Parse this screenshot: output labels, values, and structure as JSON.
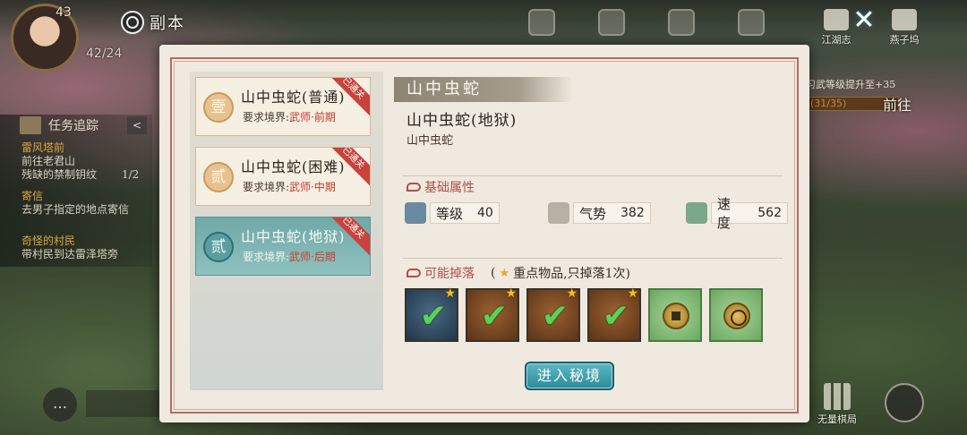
{
  "hud": {
    "player_level": "43",
    "stamina": "42/24",
    "dungeon_title": "副本",
    "right_buttons": [
      "江湖志",
      "燕子坞"
    ],
    "close_symbol": "✕",
    "board_label": "无量棋局"
  },
  "quest_tracker": {
    "title": "任务追踪",
    "collapse_symbol": "<",
    "items": [
      {
        "title": "雷风塔前",
        "desc": "前往老君山",
        "desc2": "残缺的禁制钥纹",
        "count": "1/2"
      },
      {
        "title": "寄信",
        "desc": "去男子指定的地点寄信"
      },
      {
        "title": "奇怪的村民",
        "desc": "带村民到达雷泽塔旁"
      }
    ],
    "rank_hint": "习武等级提升至+35",
    "rank_progress": "(31/35)",
    "goto_label": "前往"
  },
  "stages": [
    {
      "num": "壹",
      "title": "山中虫蛇(普通)",
      "req_label": "要求境界:",
      "req_tier": "武师·前期",
      "badge": "已通关",
      "active": false
    },
    {
      "num": "贰",
      "title": "山中虫蛇(困难)",
      "req_label": "要求境界:",
      "req_tier": "武师·中期",
      "badge": "已通关",
      "active": false
    },
    {
      "num": "贰",
      "title": "山中虫蛇(地狱)",
      "req_label": "要求境界:",
      "req_tier": "武师·后期",
      "badge": "已通关",
      "active": true
    }
  ],
  "detail": {
    "banner": "山中虫蛇",
    "title": "山中虫蛇(地狱)",
    "subtitle": "山中虫蛇",
    "base_stats_label": "基础属性",
    "stats": [
      {
        "name": "等级",
        "value": "40",
        "icon": "level-icon"
      },
      {
        "name": "气势",
        "value": "382",
        "icon": "momentum-icon"
      },
      {
        "name": "速度",
        "value": "562",
        "icon": "speed-icon"
      }
    ],
    "drops_label": "可能掉落",
    "drops_note": "重点物品,只掉落1次)",
    "drops_note_open": "(",
    "drops": [
      {
        "style": "blue",
        "icon": "check-icon",
        "starred": true
      },
      {
        "style": "brown",
        "icon": "check-icon",
        "starred": true
      },
      {
        "style": "brown",
        "icon": "check-icon",
        "starred": true
      },
      {
        "style": "brown",
        "icon": "check-icon",
        "starred": true
      },
      {
        "style": "green",
        "icon": "coin-icon",
        "starred": false
      },
      {
        "style": "green",
        "icon": "coin-icon",
        "starred": false
      }
    ],
    "enter_button": "进入秘境"
  }
}
